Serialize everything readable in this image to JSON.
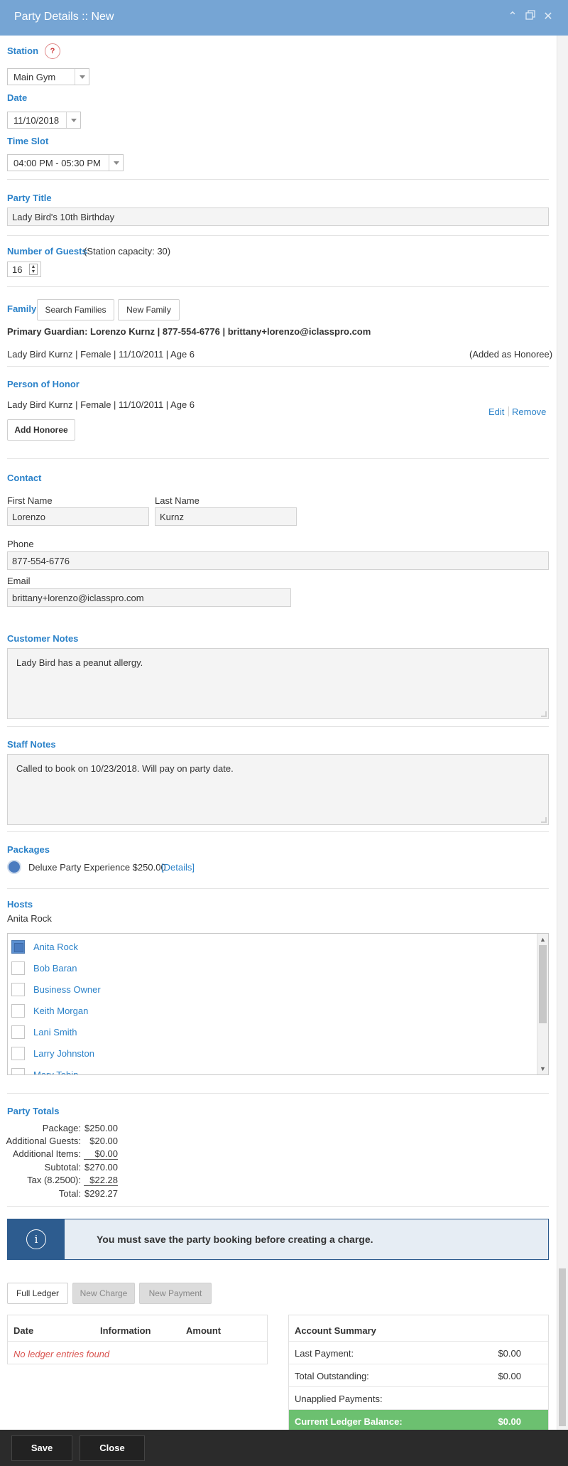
{
  "window": {
    "title": "Party Details :: New"
  },
  "station": {
    "label": "Station",
    "help": "?",
    "value": "Main Gym"
  },
  "date": {
    "label": "Date",
    "value": "11/10/2018"
  },
  "time_slot": {
    "label": "Time Slot",
    "value": "04:00 PM - 05:30 PM"
  },
  "party_title": {
    "label": "Party Title",
    "value": "Lady Bird's 10th Birthday"
  },
  "guests": {
    "label": "Number of Guests",
    "capacity": "(Station capacity: 30)",
    "value": "16"
  },
  "family": {
    "label": "Family",
    "search_btn": "Search Families",
    "new_btn": "New Family",
    "guardian": "Primary Guardian: Lorenzo Kurnz | 877-554-6776 | brittany+lorenzo@iclasspro.com",
    "member": "Lady Bird Kurnz | Female | 11/10/2011 | Age 6",
    "member_status": "(Added as Honoree)"
  },
  "honor": {
    "label": "Person of Honor",
    "person": "Lady Bird Kurnz | Female | 11/10/2011 | Age 6",
    "edit": "Edit",
    "remove": "Remove",
    "add_btn": "Add Honoree"
  },
  "contact": {
    "label": "Contact",
    "first_label": "First Name",
    "first_value": "Lorenzo",
    "last_label": "Last Name",
    "last_value": "Kurnz",
    "phone_label": "Phone",
    "phone_value": "877-554-6776",
    "email_label": "Email",
    "email_value": "brittany+lorenzo@iclasspro.com"
  },
  "customer_notes": {
    "label": "Customer Notes",
    "value": "Lady Bird has a peanut allergy."
  },
  "staff_notes": {
    "label": "Staff Notes",
    "value": "Called to book on 10/23/2018. Will pay on party date."
  },
  "packages": {
    "label": "Packages",
    "item": "Deluxe Party Experience $250.00",
    "details": "[Details]"
  },
  "hosts": {
    "label": "Hosts",
    "selected": "Anita Rock",
    "list": [
      {
        "name": "Anita Rock",
        "checked": true
      },
      {
        "name": "Bob Baran",
        "checked": false
      },
      {
        "name": "Business Owner",
        "checked": false
      },
      {
        "name": "Keith Morgan",
        "checked": false
      },
      {
        "name": "Lani Smith",
        "checked": false
      },
      {
        "name": "Larry Johnston",
        "checked": false
      },
      {
        "name": "Mary Tobin",
        "checked": false
      }
    ]
  },
  "totals": {
    "label": "Party Totals",
    "rows": [
      {
        "label": "Package:",
        "value": "$250.00"
      },
      {
        "label": "Additional Guests:",
        "value": "$20.00"
      },
      {
        "label": "Additional Items:",
        "value": "$0.00"
      },
      {
        "label": "Subtotal:",
        "value": "$270.00"
      },
      {
        "label": "Tax (8.2500):",
        "value": "$22.28"
      },
      {
        "label": "Total:",
        "value": "$292.27"
      }
    ]
  },
  "alert": {
    "icon": "i",
    "message": "You must save the party booking before creating a charge."
  },
  "ledger_buttons": {
    "full": "Full Ledger",
    "charge": "New Charge",
    "payment": "New Payment"
  },
  "ledger": {
    "col_date": "Date",
    "col_info": "Information",
    "col_amount": "Amount",
    "empty": "No ledger entries found"
  },
  "summary": {
    "title": "Account Summary",
    "last_payment_label": "Last Payment:",
    "last_payment_value": "$0.00",
    "outstanding_label": "Total Outstanding:",
    "outstanding_value": "$0.00",
    "unapplied_label": "Unapplied Payments:",
    "balance_label": "Current Ledger Balance:",
    "balance_value": "$0.00"
  },
  "footer": {
    "save": "Save",
    "close": "Close"
  },
  "colors": {
    "titlebar": "#76a5d4",
    "accent": "#2b82c9",
    "alert": "#2d5c8f",
    "balance": "#6cc070"
  }
}
